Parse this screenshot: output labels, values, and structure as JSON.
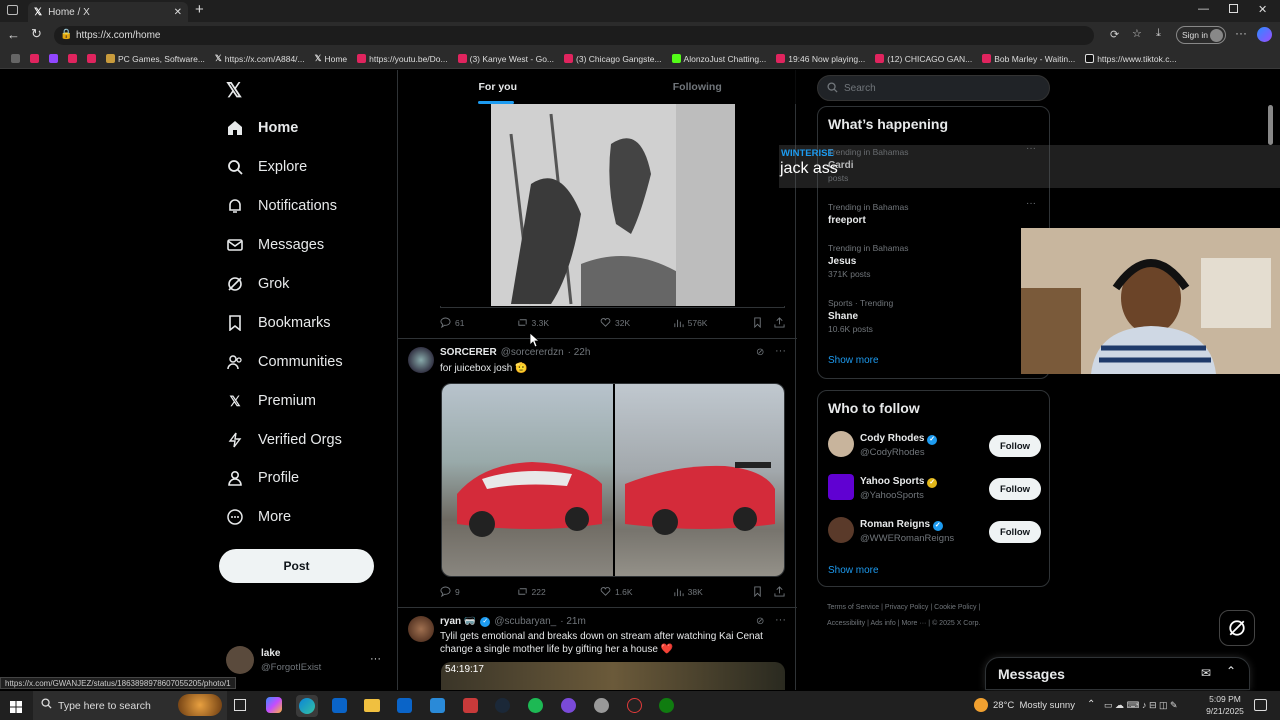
{
  "browser": {
    "tab_title": "Home / X",
    "url": "https://x.com/home",
    "sign_in": "Sign in",
    "bookmarks": [
      "PC Games, Software...",
      "https://x.com/A884/...",
      "Home",
      "https://youtu.be/Do...",
      "(3) Kanye West - Go...",
      "(3) Chicago Gangste...",
      "AlonzoJust Chatting...",
      "19:46 Now playing...",
      "(12) CHICAGO GAN...",
      "Bob Marley - Waitin...",
      "https://www.tiktok.c..."
    ],
    "status_url": "https://x.com/GWANJEZ/status/1863898978607055205/photo/1"
  },
  "sidebar": {
    "items": [
      {
        "label": "Home",
        "icon": "home-icon"
      },
      {
        "label": "Explore",
        "icon": "search-icon"
      },
      {
        "label": "Notifications",
        "icon": "bell-icon"
      },
      {
        "label": "Messages",
        "icon": "mail-icon"
      },
      {
        "label": "Grok",
        "icon": "grok-icon"
      },
      {
        "label": "Bookmarks",
        "icon": "bookmark-icon"
      },
      {
        "label": "Communities",
        "icon": "people-icon"
      },
      {
        "label": "Premium",
        "icon": "x-logo-icon"
      },
      {
        "label": "Verified Orgs",
        "icon": "bolt-icon"
      },
      {
        "label": "Profile",
        "icon": "person-icon"
      },
      {
        "label": "More",
        "icon": "more-circle-icon"
      }
    ],
    "post_label": "Post",
    "account": {
      "name": "lake",
      "handle": "@ForgotIExist"
    }
  },
  "feed": {
    "tabs": [
      "For you",
      "Following"
    ],
    "tweet1": {
      "replies": "61",
      "retweets": "3.3K",
      "likes": "32K",
      "views": "576K"
    },
    "tweet2": {
      "name": "SORCERER",
      "handle": "@sorcererdzn",
      "time": "· 22h",
      "text": "for juicebox josh 🫡",
      "replies": "9",
      "retweets": "222",
      "likes": "1.6K",
      "views": "38K"
    },
    "tweet3": {
      "name": "ryan 🥽",
      "handle": "@scubaryan_",
      "time": "· 21m",
      "text": "Tylil gets emotional and breaks down on stream after watching Kai Cenat change a single mother life by gifting her a house ❤️",
      "video_time": "54:19:17"
    }
  },
  "right": {
    "search_placeholder": "Search",
    "happening_title": "What’s happening",
    "trends": [
      {
        "meta": "Trending in Bahamas",
        "name": "Cardi",
        "posts": "posts"
      },
      {
        "meta": "Trending in Bahamas",
        "name": "freeport",
        "posts": ""
      },
      {
        "meta": "Trending in Bahamas",
        "name": "Jesus",
        "posts": "371K posts"
      },
      {
        "meta": "Sports · Trending",
        "name": "Shane",
        "posts": "10.6K posts"
      }
    ],
    "show_more": "Show more",
    "who_title": "Who to follow",
    "who": [
      {
        "name": "Cody Rhodes",
        "handle": "@CodyRhodes"
      },
      {
        "name": "Yahoo Sports",
        "handle": "@YahooSports"
      },
      {
        "name": "Roman Reigns",
        "handle": "@WWERomanReigns"
      }
    ],
    "follow_label": "Follow",
    "footer": [
      "Terms of Service",
      "Privacy Policy",
      "Cookie Policy",
      "Accessibility",
      "Ads info",
      "More ···",
      "© 2025 X Corp."
    ],
    "messages_label": "Messages"
  },
  "overlay": {
    "tag": "WINTERISE",
    "text": "jack ass"
  },
  "taskbar": {
    "search_placeholder": "Type here to search",
    "weather": "28°C  Mostly sunny",
    "time": "5:09 PM",
    "date": "9/21/2025"
  }
}
